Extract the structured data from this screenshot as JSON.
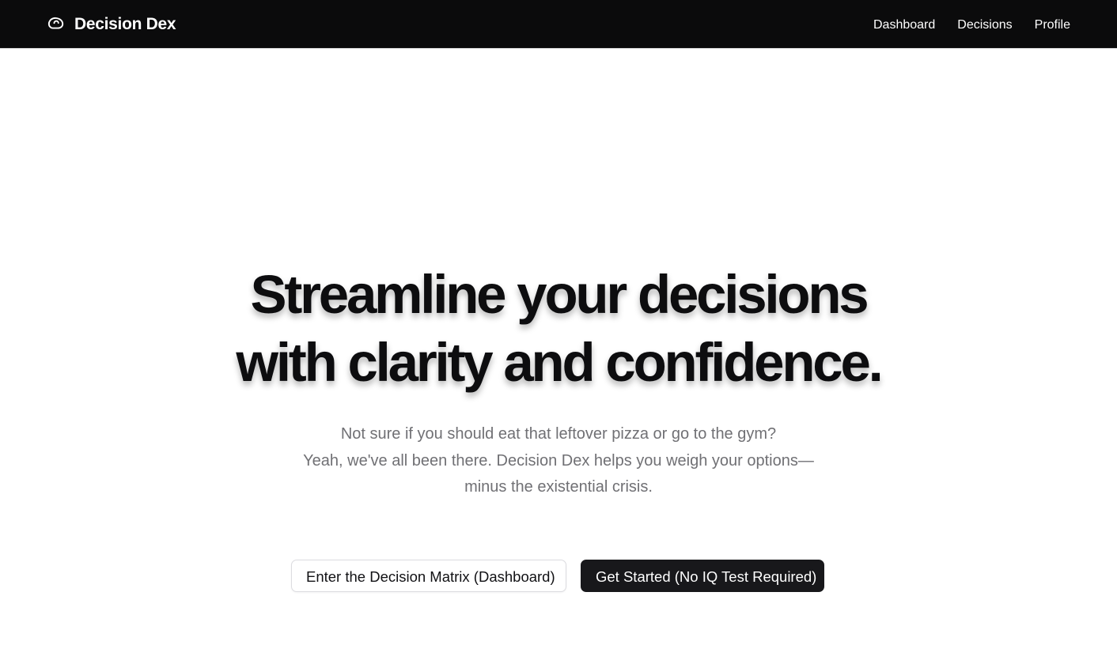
{
  "navbar": {
    "brand": {
      "icon": "brain-bubble-icon",
      "name": "Decision Dex"
    },
    "links": [
      {
        "label": "Dashboard"
      },
      {
        "label": "Decisions"
      },
      {
        "label": "Profile"
      }
    ]
  },
  "hero": {
    "title_line1": "Streamline your decisions",
    "title_line2": "with clarity and confidence.",
    "subtitle_line1": "Not sure if you should eat that leftover pizza or go to the gym?",
    "subtitle_line2": "Yeah, we've all been there. Decision Dex helps you weigh your options—",
    "subtitle_line3": "minus the existential crisis."
  },
  "cta": {
    "secondary_label": "Enter the Decision Matrix (Dashboard)",
    "primary_label": "Get Started (No IQ Test Required)"
  },
  "colors": {
    "navbar_bg": "#0b0b0c",
    "primary_button_bg": "#18181b",
    "subtitle_text": "#707074"
  }
}
